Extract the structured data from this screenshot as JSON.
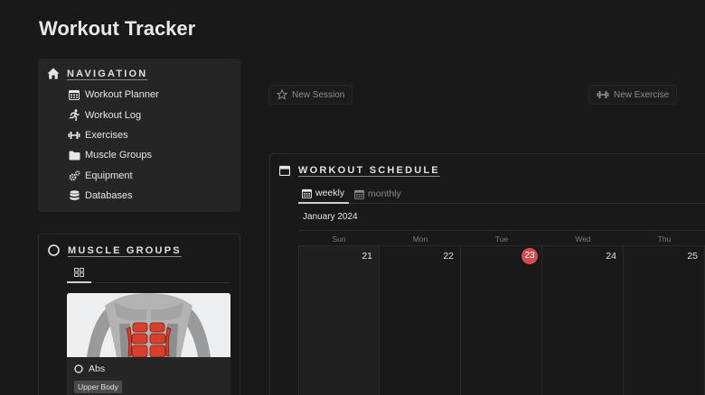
{
  "page": {
    "title": "Workout Tracker"
  },
  "navigation": {
    "heading": "NAVIGATION",
    "items": [
      {
        "label": "Workout Planner",
        "icon": "calendar-icon"
      },
      {
        "label": "Workout Log",
        "icon": "running-icon"
      },
      {
        "label": "Exercises",
        "icon": "dumbbell-icon"
      },
      {
        "label": "Muscle Groups",
        "icon": "folder-icon"
      },
      {
        "label": "Equipment",
        "icon": "gears-icon"
      },
      {
        "label": "Databases",
        "icon": "database-icon"
      }
    ]
  },
  "actions": {
    "new_session": "New Session",
    "new_exercise": "New Exercise"
  },
  "muscle_groups": {
    "heading": "MUSCLE GROUPS",
    "cards": [
      {
        "title": "Abs",
        "tag": "Upper Body"
      }
    ]
  },
  "schedule": {
    "heading": "WORKOUT SCHEDULE",
    "tabs": [
      {
        "label": "weekly"
      },
      {
        "label": "monthly"
      }
    ],
    "month": "January 2024",
    "days": [
      {
        "name": "Sun",
        "num": "21"
      },
      {
        "name": "Mon",
        "num": "22"
      },
      {
        "name": "Tue",
        "num": "23"
      },
      {
        "name": "Wed",
        "num": "24"
      },
      {
        "name": "Thu",
        "num": "25"
      }
    ]
  },
  "colors": {
    "background": "#191919",
    "panel": "#252525",
    "today": "#d44b4b"
  }
}
